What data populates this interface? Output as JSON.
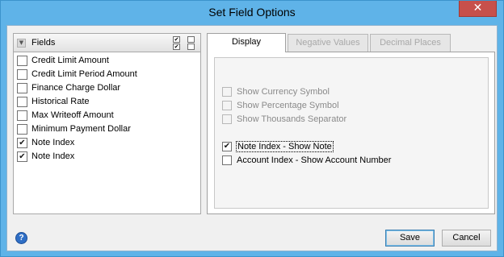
{
  "window": {
    "title": "Set Field Options",
    "close_glyph": "✕"
  },
  "fields": {
    "header": "Fields",
    "items": [
      {
        "label": "Credit Limit Amount",
        "checked": false
      },
      {
        "label": "Credit Limit Period Amount",
        "checked": false
      },
      {
        "label": "Finance Charge Dollar",
        "checked": false
      },
      {
        "label": "Historical Rate",
        "checked": false
      },
      {
        "label": "Max Writeoff Amount",
        "checked": false
      },
      {
        "label": "Minimum Payment Dollar",
        "checked": false
      },
      {
        "label": "Note Index",
        "checked": true
      },
      {
        "label": "Note Index",
        "checked": true
      }
    ]
  },
  "tabs": [
    {
      "label": "Display",
      "active": true
    },
    {
      "label": "Negative Values",
      "active": false
    },
    {
      "label": "Decimal Places",
      "active": false
    }
  ],
  "display": {
    "options": [
      {
        "label": "Show Currency Symbol",
        "checked": false,
        "enabled": false
      },
      {
        "label": "Show Percentage Symbol",
        "checked": false,
        "enabled": false
      },
      {
        "label": "Show Thousands Separator",
        "checked": false,
        "enabled": false
      },
      {
        "label": "Note Index - Show Note",
        "checked": true,
        "enabled": true
      },
      {
        "label": "Account Index - Show Account Number",
        "checked": false,
        "enabled": true
      }
    ]
  },
  "footer": {
    "help_glyph": "?",
    "save_label": "Save",
    "cancel_label": "Cancel"
  },
  "icons": {
    "check": "✔",
    "collapse": "▼"
  },
  "colors": {
    "title_bar": "#5fb3e8",
    "dialog_bg": "#f0f0f0"
  }
}
